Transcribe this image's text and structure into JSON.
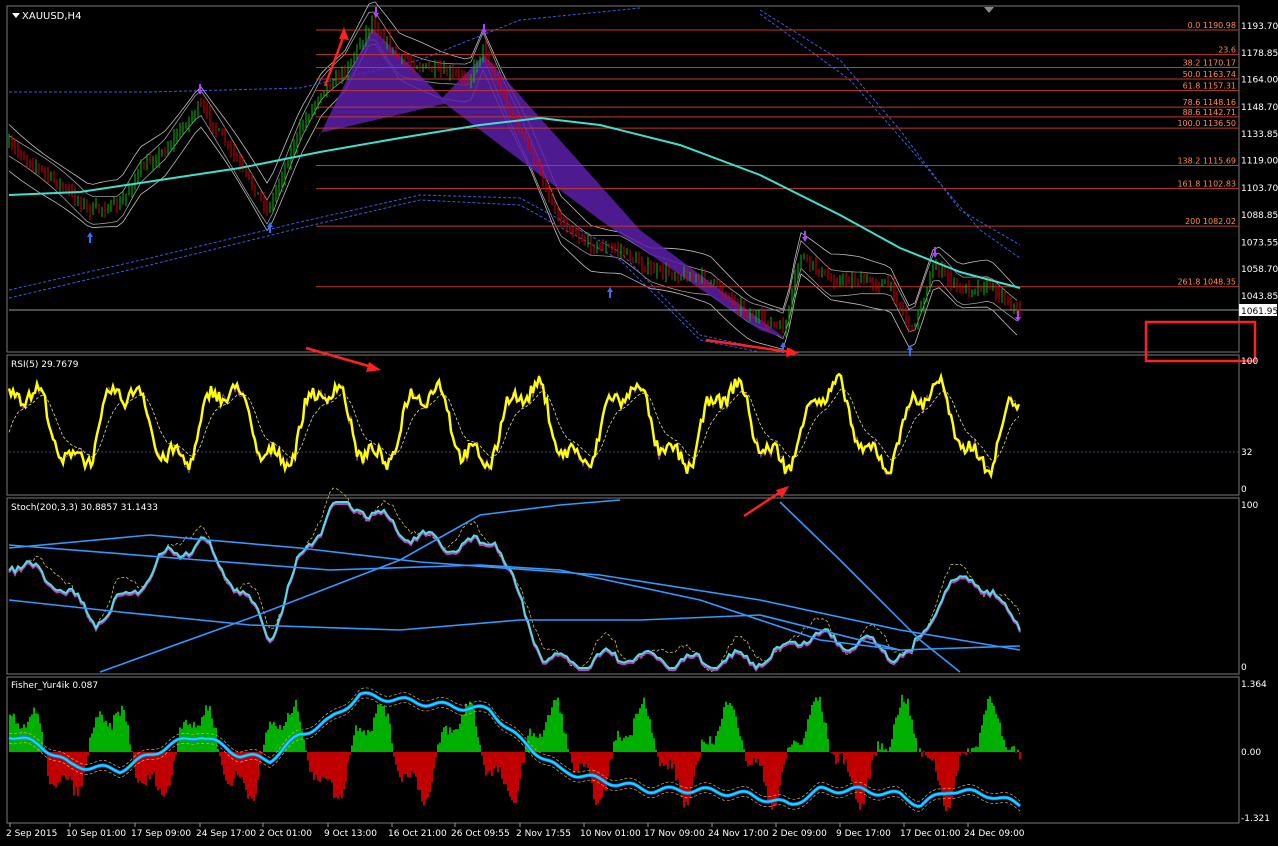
{
  "symbol_title": "XAUUSD,H4",
  "price_axis": {
    "labels": [
      "1193.70",
      "1178.85",
      "1164.00",
      "1148.70",
      "1133.85",
      "1119.00",
      "1103.70",
      "1088.85",
      "1073.55",
      "1058.70",
      "1043.85"
    ],
    "current_price": "1061.95"
  },
  "fibonacci_levels": [
    {
      "label": "0.0 1190.98",
      "value": 1190.98
    },
    {
      "label": "23.6",
      "value": 1177.3
    },
    {
      "label": "38.2 1170.17",
      "value": 1170.17
    },
    {
      "label": "50.0 1163.74",
      "value": 1163.74
    },
    {
      "label": "61.8 1157.31",
      "value": 1157.31
    },
    {
      "label": "78.6 1148.16",
      "value": 1148.16
    },
    {
      "label": "88.6 1142.71",
      "value": 1142.71
    },
    {
      "label": "100.0 1136.50",
      "value": 1136.5
    },
    {
      "label": "138.2 1115.69",
      "value": 1115.69
    },
    {
      "label": "161.8 1102.83",
      "value": 1102.83
    },
    {
      "label": "200 1082.02",
      "value": 1082.02
    },
    {
      "label": "261.8 1048.35",
      "value": 1048.35
    }
  ],
  "rsi": {
    "title": "RSI(5) 29.7679",
    "axis": [
      "100",
      "32",
      "0"
    ],
    "last_value": 29.7679
  },
  "stoch": {
    "title": "Stoch(200,3,3) 30.8857 31.1433",
    "axis": [
      "100",
      "0"
    ],
    "main": 30.8857,
    "signal": 31.1433
  },
  "fisher": {
    "title": "Fisher_Yur4ik 0.087",
    "axis": [
      "1.364",
      "0.00",
      "-1.321"
    ],
    "value": 0.087
  },
  "time_axis": [
    "2 Sep 2015",
    "10 Sep 01:00",
    "17 Sep 09:00",
    "24 Sep 17:00",
    "2 Oct 01:00",
    "9 Oct 13:00",
    "16 Oct 21:00",
    "26 Oct 09:55",
    "2 Nov 17:55",
    "10 Nov 01:00",
    "17 Nov 09:00",
    "24 Nov 17:00",
    "2 Dec 09:00",
    "9 Dec 17:00",
    "17 Dec 01:00",
    "24 Dec 09:00"
  ],
  "colors": {
    "background": "#000000",
    "bull_candle": "#00c000",
    "bear_candle": "#e00000",
    "fib_line": "#c0392b",
    "fib_text": "#ff8c4a",
    "rsi_line": "#ffff00",
    "stoch_line": "#3399ff",
    "fisher_line": "#00e5ff",
    "fisher_pos": "#00b000",
    "fisher_neg": "#c00000",
    "annotation": "#ff2020",
    "ma_cyan": "#40e0d0",
    "channel_purple": "#5a1fa8"
  }
}
